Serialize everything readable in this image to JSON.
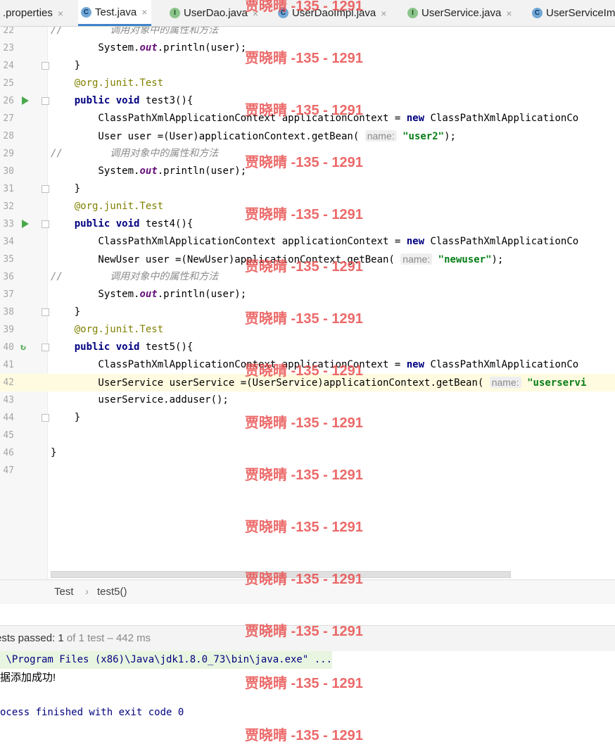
{
  "tabs": [
    {
      "label": ".properties",
      "icon": "",
      "active": false
    },
    {
      "label": "Test.java",
      "icon": "c",
      "active": true
    },
    {
      "label": "UserDao.java",
      "icon": "i",
      "active": false
    },
    {
      "label": "UserDaoImpl.java",
      "icon": "c",
      "active": false
    },
    {
      "label": "UserService.java",
      "icon": "i",
      "active": false
    },
    {
      "label": "UserServiceIm",
      "icon": "c",
      "active": false
    }
  ],
  "close_glyph": "×",
  "editor": {
    "current_line": "42",
    "lines": [
      {
        "num": "22",
        "code": "//        调用对象中的属性和方法"
      },
      {
        "num": "23",
        "code": "        System.out.println(user);"
      },
      {
        "num": "24",
        "code": "    }"
      },
      {
        "num": "25",
        "code": "    @org.junit.Test"
      },
      {
        "num": "26",
        "code": "    public void test3(){"
      },
      {
        "num": "27",
        "code": "        ClassPathXmlApplicationContext applicationContext = new ClassPathXmlApplicationCo"
      },
      {
        "num": "28",
        "code": "        User user =(User)applicationContext.getBean( name: \"user2\");"
      },
      {
        "num": "29",
        "code": "//        调用对象中的属性和方法"
      },
      {
        "num": "30",
        "code": "        System.out.println(user);"
      },
      {
        "num": "31",
        "code": "    }"
      },
      {
        "num": "32",
        "code": "    @org.junit.Test"
      },
      {
        "num": "33",
        "code": "    public void test4(){"
      },
      {
        "num": "34",
        "code": "        ClassPathXmlApplicationContext applicationContext = new ClassPathXmlApplicationCo"
      },
      {
        "num": "35",
        "code": "        NewUser user =(NewUser)applicationContext.getBean( name: \"newuser\");"
      },
      {
        "num": "36",
        "code": "//        调用对象中的属性和方法"
      },
      {
        "num": "37",
        "code": "        System.out.println(user);"
      },
      {
        "num": "38",
        "code": "    }"
      },
      {
        "num": "39",
        "code": "    @org.junit.Test"
      },
      {
        "num": "40",
        "code": "    public void test5(){"
      },
      {
        "num": "41",
        "code": "        ClassPathXmlApplicationContext applicationContext = new ClassPathXmlApplicationCo"
      },
      {
        "num": "42",
        "code": "        UserService userService =(UserService)applicationContext.getBean( name: \"userservi"
      },
      {
        "num": "43",
        "code": "        userService.adduser();"
      },
      {
        "num": "44",
        "code": "    }"
      },
      {
        "num": "45",
        "code": ""
      },
      {
        "num": "46",
        "code": "}"
      },
      {
        "num": "47",
        "code": ""
      }
    ]
  },
  "breadcrumb": {
    "class": "Test",
    "separator": "›",
    "method": "test5()"
  },
  "status": {
    "passed_label": "ests passed: ",
    "passed_count": "1",
    "total": "of 1 test",
    "duration": "– 442 ms"
  },
  "console": {
    "command": " \\Program Files (x86)\\Java\\jdk1.8.0_73\\bin\\java.exe\" ...",
    "output": "据添加成功!",
    "exit": "ocess finished with exit code 0"
  },
  "watermark": "贾晓晴 -135 - 1291"
}
